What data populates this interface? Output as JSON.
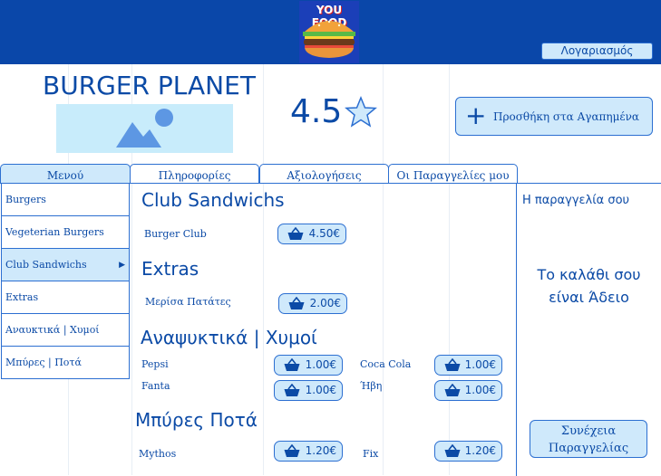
{
  "header": {
    "logo_text": "YOU FOOD",
    "account_label": "Λογαριασμός"
  },
  "restaurant": {
    "name": "BURGER PLANET",
    "rating": "4.5",
    "favorite_label": "Προσθήκη στα Αγαπημένα"
  },
  "tabs": [
    {
      "label": "Μενού",
      "active": true
    },
    {
      "label": "Πληροφορίες",
      "active": false
    },
    {
      "label": "Αξιολογήσεις",
      "active": false
    },
    {
      "label": "Οι Παραγγελίες μου",
      "active": false
    }
  ],
  "menu": {
    "items": [
      {
        "label": "Burgers"
      },
      {
        "label": "Vegeterian Burgers"
      },
      {
        "label": "Club Sandwichs",
        "active": true,
        "arrow": "▶"
      },
      {
        "label": "Extras"
      },
      {
        "label": "Αναυκτικά | Χυμοί"
      },
      {
        "label": "Μπύρες | Ποτά"
      }
    ]
  },
  "sections": {
    "club": {
      "title": "Club Sandwichs",
      "items": [
        {
          "name": "Burger Club",
          "price": "4.50€"
        }
      ]
    },
    "extras": {
      "title": "Extras",
      "items": [
        {
          "name": "Μερίσα Πατάτες",
          "price": "2.00€"
        }
      ]
    },
    "drinks": {
      "title": "Αναψυκτικά | Χυμοί",
      "items": [
        {
          "name": "Pepsi",
          "price": "1.00€"
        },
        {
          "name": "Coca Cola",
          "price": "1.00€"
        },
        {
          "name": "Fanta",
          "price": "1.00€"
        },
        {
          "name": "Ήβη",
          "price": "1.00€"
        }
      ]
    },
    "beers": {
      "title": "Μπύρες Ποτά",
      "items": [
        {
          "name": "Mythos",
          "price": "1.20€"
        },
        {
          "name": "Fix",
          "price": "1.20€"
        }
      ]
    }
  },
  "order": {
    "title": "Η παραγγελία σου",
    "empty_line1": "Το καλάθι σου",
    "empty_line2": "είναι Άδειο",
    "continue_line1": "Συνέχεια",
    "continue_line2": "Παραγγελίας"
  },
  "icons": {
    "logo": "burger-logo-icon",
    "image_placeholder": "image-placeholder-icon",
    "rating_star": "star-outline-icon",
    "favorite": "plus-icon",
    "price_button": "basket-icon"
  },
  "colors": {
    "header_bg": "#0a47a9",
    "accent": "#0b4aa6",
    "button_bg": "#cfe9fb",
    "border": "#2c6fd1"
  }
}
